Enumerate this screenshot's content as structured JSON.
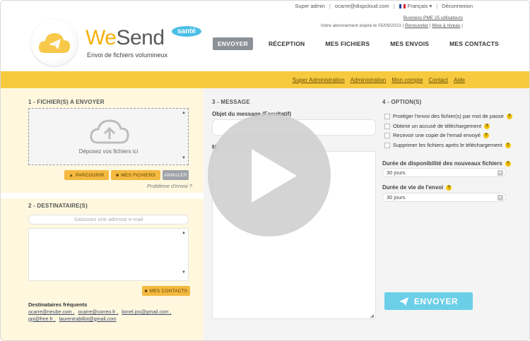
{
  "topbar": {
    "role": "Super admin",
    "email": "ocarre@dispcloud.com",
    "language": "Français",
    "logout": "Déconnexion"
  },
  "subscription": {
    "line1": "Business PME 25 utilisateurs",
    "line2_prefix": "Votre abonnement expire le 05/09/2023 |",
    "renew": "Renouveler",
    "upgrade": "Mise à niveau"
  },
  "brand": {
    "we": "We",
    "send": "Send",
    "badge": "santé",
    "tagline": "Envoi de fichiers volumineux"
  },
  "nav": {
    "items": [
      "ENVOYER",
      "RÉCEPTION",
      "MES FICHIERS",
      "MES ENVOIS",
      "MES CONTACTS"
    ]
  },
  "adminbar": {
    "items": [
      "Super Administration",
      "Administration",
      "Mon compte",
      "Contact",
      "Aide"
    ]
  },
  "files": {
    "title": "1 - FICHIER(S) A ENVOYER",
    "dropzone": "Déposez vos fichiers ici",
    "browse": "PARCOURIR",
    "my_files": "MES FICHIERS",
    "cancel": "ANNULER",
    "problem": "Problème d'envoi ?"
  },
  "recipients": {
    "title": "2 - DESTINATAIRE(S)",
    "placeholder": "Saisissez une adresse e-mail",
    "contacts_btn": "MES CONTACTS",
    "frequent_title": "Destinataires fréquents",
    "frequent": [
      "ocarre@neube.com ,",
      "ocarre@correo.fr ,",
      "lionel.jos@gmail.com ,",
      "ppi@free.fr ,",
      "laurentrabillot@gmail.com"
    ]
  },
  "message": {
    "title": "3 - MESSAGE",
    "subject_label": "Objet du message (Facultatif)",
    "message_label": "M"
  },
  "options": {
    "title": "4 - OPTION(S)",
    "items": [
      "Protéger l'envoi des fichier(s) par mot de passe",
      "Obtenir un accusé de téléchargement",
      "Recevoir une copie de l'email envoyé",
      "Supprimer les fichiers après le téléchargement"
    ],
    "availability_label": "Durée de disponibilité des nouveaux fichiers",
    "availability_value": "30 jours",
    "lifetime_label": "Durée de vie de l'envoi",
    "lifetime_value": "30 jours"
  },
  "send_button": "ENVOYER",
  "colors": {
    "accent_yellow": "#f6c93f",
    "send_blue": "#6ccfe8",
    "active_nav": "#8c9197"
  }
}
